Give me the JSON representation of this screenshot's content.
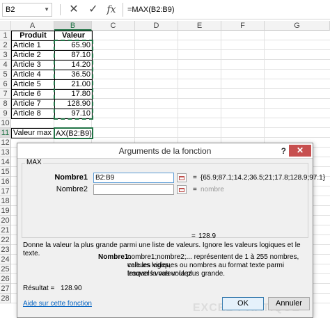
{
  "formula_bar": {
    "namebox": "B2",
    "formula": "=MAX(B2:B9)",
    "cancel_glyph": "✕",
    "enter_glyph": "✓",
    "fx_glyph": "fx"
  },
  "columns": [
    "A",
    "B",
    "C",
    "D",
    "E",
    "F",
    "G"
  ],
  "rows": [
    "1",
    "2",
    "3",
    "4",
    "5",
    "6",
    "7",
    "8",
    "9",
    "10",
    "11",
    "12",
    "13",
    "14",
    "15",
    "16",
    "17",
    "18",
    "19",
    "20",
    "21",
    "22",
    "23",
    "24",
    "25",
    "26",
    "27",
    "28"
  ],
  "sheet": {
    "header": {
      "produit": "Produit",
      "valeur": "Valeur"
    },
    "products": [
      "Article 1",
      "Article 2",
      "Article 3",
      "Article 4",
      "Article 5",
      "Article 6",
      "Article 7",
      "Article 8"
    ],
    "values": [
      "65.90",
      "87.10",
      "14.20",
      "36.50",
      "21.00",
      "17.80",
      "128.90",
      "97.10"
    ],
    "max_label": "Valeur max :",
    "max_formula": "AX(B2:B9)"
  },
  "dialog": {
    "title": "Arguments de la fonction",
    "help": "?",
    "close": "✕",
    "function_name": "MAX",
    "arg1_label": "Nombre1",
    "arg1_value": "B2:B9",
    "arg1_result": "{65.9;87.1;14.2;36.5;21;17.8;128.9;97.1}",
    "arg2_label": "Nombre2",
    "arg2_value": "",
    "arg2_result": "nombre",
    "equals": "=",
    "func_result": "128.9",
    "description": "Donne la valeur la plus grande parmi une liste de valeurs. Ignore les valeurs logiques et le texte.",
    "arg_help_label": "Nombre1:",
    "arg_help_line1": "nombre1;nombre2;... représentent de 1 à 255 nombres, cellules vides,",
    "arg_help_line2": "valeurs logiques ou nombres au format texte parmi lesquels vous voulez",
    "arg_help_line3": "trouver la valeur la plus grande.",
    "result_label": "Résultat =",
    "result_value": "128.90",
    "help_link": "Aide sur cette fonction",
    "ok": "OK",
    "cancel": "Annuler",
    "watermark": "EXCEL-PRATIQUE"
  }
}
